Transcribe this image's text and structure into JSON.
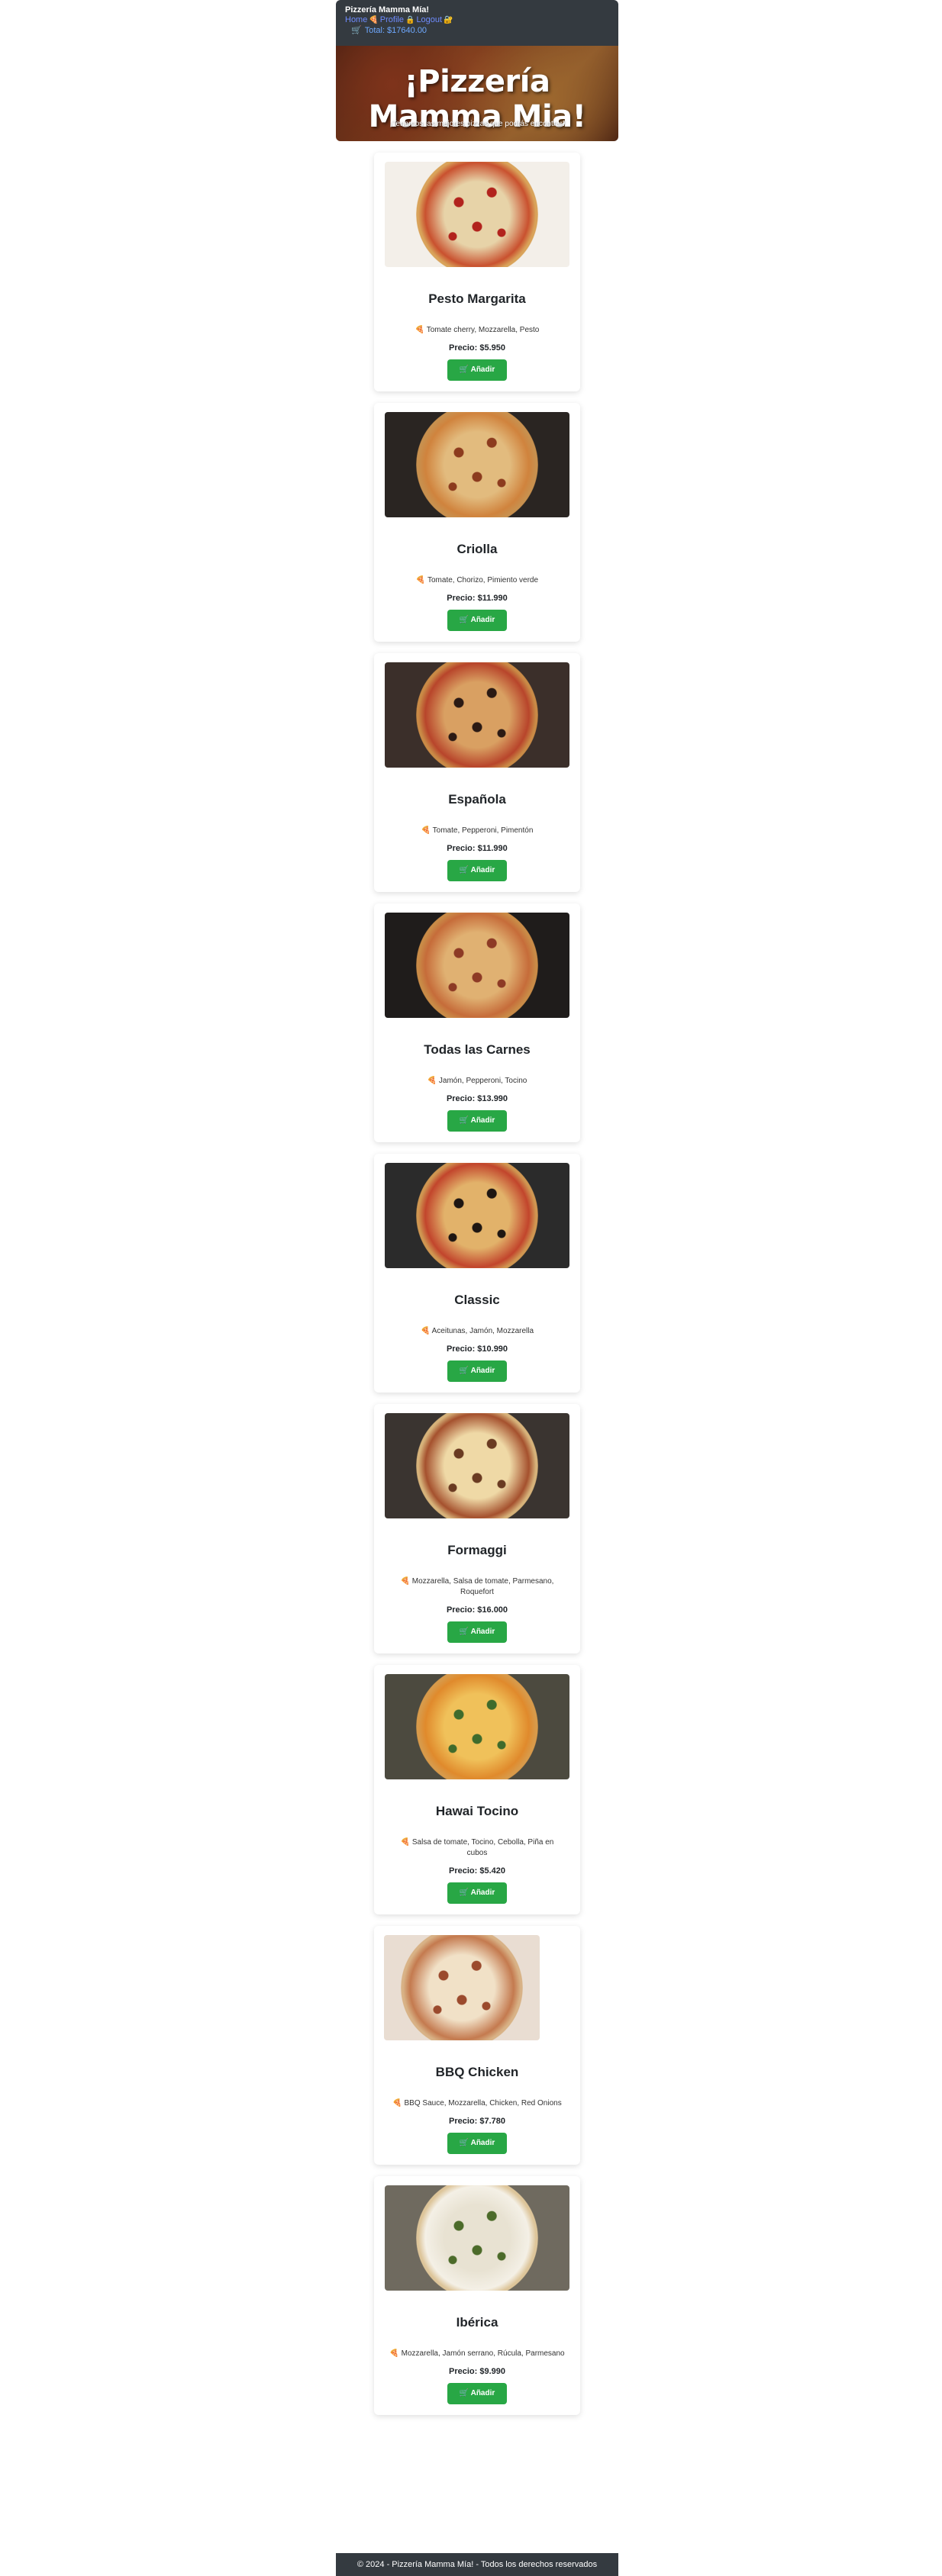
{
  "navbar": {
    "brand": "Pizzería Mamma Mía!",
    "links": [
      {
        "label": "Home",
        "icon": "🍕"
      },
      {
        "label": "Profile",
        "icon": "🔒"
      },
      {
        "label": "Logout",
        "icon": "🔐"
      }
    ],
    "total_icon": "🛒",
    "total_label": "Total: $17640.00"
  },
  "hero": {
    "title": "¡Pizzería Mamma Mia!",
    "subtitle": "¡Tenemos las mejores pizzas que podrás encontrar!"
  },
  "pizzas": [
    {
      "name": "Pesto Margarita",
      "ingredients": "Tomate cherry, Mozzarella, Pesto",
      "price": "Precio: $5.950",
      "button": "Añadir"
    },
    {
      "name": "Criolla",
      "ingredients": "Tomate, Chorizo, Pimiento verde",
      "price": "Precio: $11.990",
      "button": "Añadir"
    },
    {
      "name": "Española",
      "ingredients": "Tomate, Pepperoni, Pimentón",
      "price": "Precio: $11.990",
      "button": "Añadir"
    },
    {
      "name": "Todas las Carnes",
      "ingredients": "Jamón, Pepperoni, Tocino",
      "price": "Precio: $13.990",
      "button": "Añadir"
    },
    {
      "name": "Classic",
      "ingredients": "Aceitunas, Jamón, Mozzarella",
      "price": "Precio: $10.990",
      "button": "Añadir"
    },
    {
      "name": "Formaggi",
      "ingredients": "Mozzarella, Salsa de tomate, Parmesano, Roquefort",
      "price": "Precio: $16.000",
      "button": "Añadir"
    },
    {
      "name": "Hawai Tocino",
      "ingredients": "Salsa de tomate, Tocino, Cebolla, Piña en cubos",
      "price": "Precio: $5.420",
      "button": "Añadir"
    },
    {
      "name": "BBQ Chicken",
      "ingredients": "BBQ Sauce, Mozzarella, Chicken, Red Onions",
      "price": "Precio: $7.780",
      "button": "Añadir"
    },
    {
      "name": "Ibérica",
      "ingredients": "Mozzarella, Jamón serrano, Rúcula, Parmesano",
      "price": "Precio: $9.990",
      "button": "Añadir"
    }
  ],
  "ingredient_icon": "🍕",
  "button_icon": "🛒",
  "footer": {
    "text": "© 2024 - Pizzería Mamma Mía! - Todos los derechos reservados"
  },
  "colors": {
    "navbar_bg": "#343a40",
    "button_green": "#28a745",
    "link_blue": "#6f8cff"
  }
}
